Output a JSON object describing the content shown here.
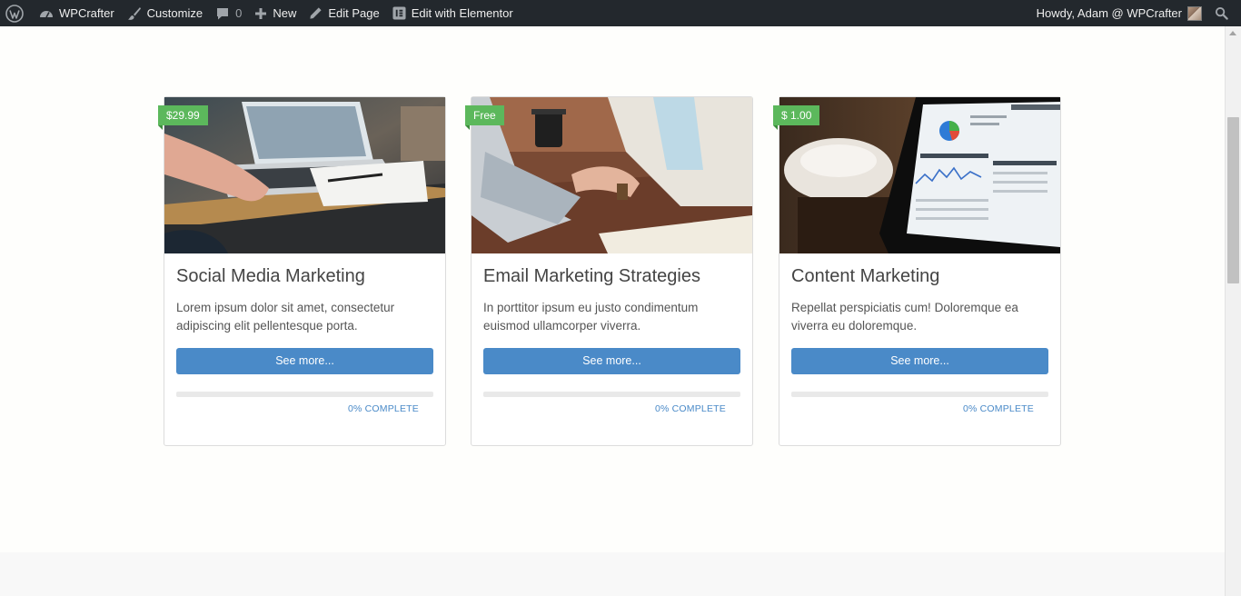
{
  "adminbar": {
    "site_name": "WPCrafter",
    "customize": "Customize",
    "comments_count": "0",
    "new": "New",
    "edit_page": "Edit Page",
    "edit_elementor": "Edit with Elementor",
    "howdy": "Howdy, Adam @ WPCrafter"
  },
  "courses": [
    {
      "price": "$29.99",
      "title": "Social Media Marketing",
      "description": "Lorem ipsum dolor sit amet, consectetur adipiscing elit pellentesque porta.",
      "button": "See more...",
      "progress_percent": 0,
      "progress_label": "0% COMPLETE"
    },
    {
      "price": "Free",
      "title": "Email Marketing Strategies",
      "description": "In porttitor ipsum eu justo condimentum euismod ullamcorper viverra.",
      "button": "See more...",
      "progress_percent": 0,
      "progress_label": "0% COMPLETE"
    },
    {
      "price": "$ 1.00",
      "title": "Content Marketing",
      "description": "Repellat perspiciatis cum! Doloremque ea viverra eu doloremque.",
      "button": "See more...",
      "progress_percent": 0,
      "progress_label": "0% COMPLETE"
    }
  ],
  "colors": {
    "adminbar_bg": "#23282d",
    "price_badge": "#5cb85c",
    "button": "#4a8ac8",
    "progress_text": "#4a8ac8"
  },
  "icons": [
    "wordpress-icon",
    "dashboard-icon",
    "paintbrush-icon",
    "comment-icon",
    "plus-icon",
    "pencil-icon",
    "elementor-icon",
    "search-icon"
  ]
}
